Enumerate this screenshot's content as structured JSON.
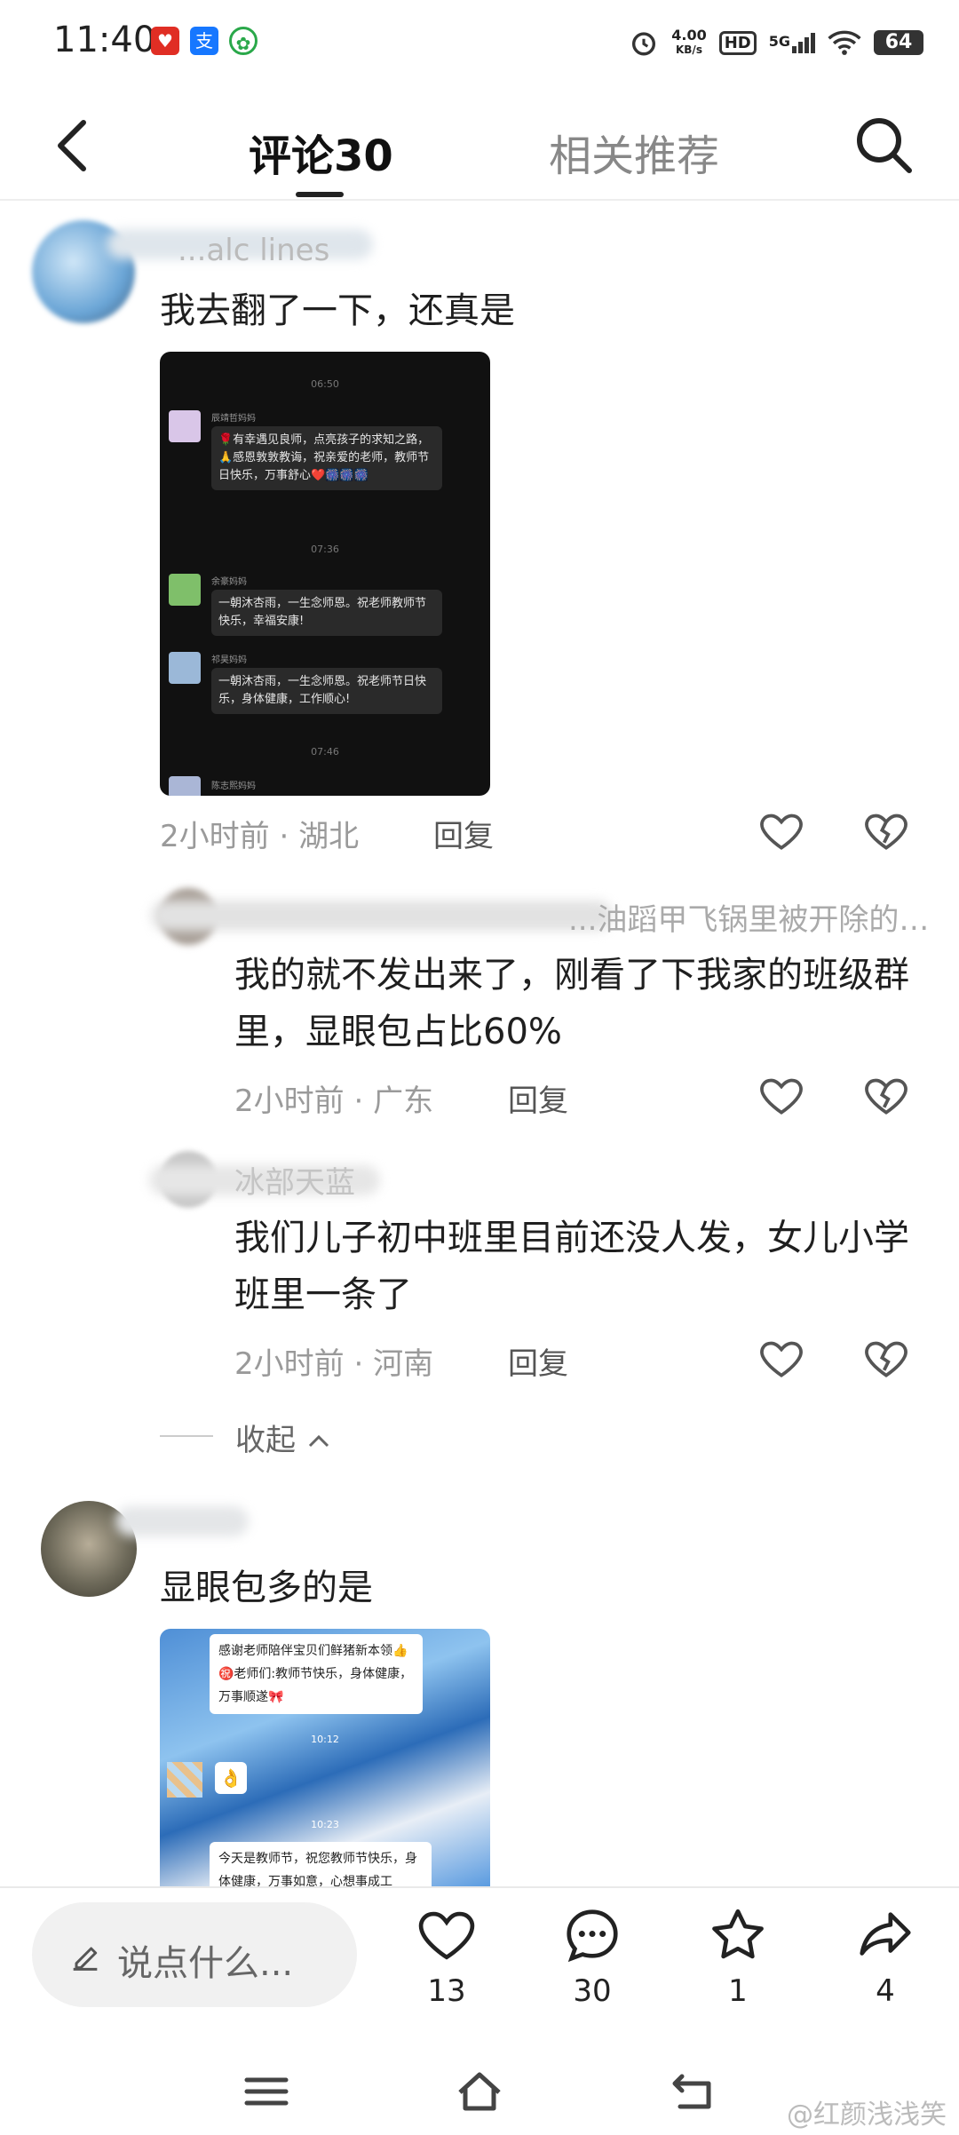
{
  "status_bar": {
    "time": "11:40",
    "net_speed": "4.00",
    "net_unit": "KB/s",
    "hd": "HD",
    "signal": "5G",
    "battery": "64"
  },
  "nav": {
    "tabs": [
      {
        "label": "评论30"
      },
      {
        "label": "相关推荐"
      }
    ]
  },
  "comments": [
    {
      "name": "...alc lines",
      "text": "我去翻了一下，还真是",
      "time": "2小时前",
      "location": "湖北",
      "reply": "回复",
      "image": {
        "times": [
          "06:50",
          "07:36",
          "07:46"
        ],
        "messages": [
          {
            "name": "辰靖哲妈妈",
            "text": "🌹有幸遇见良师，点亮孩子的求知之路，🙏感恩敦敦教诲，祝亲爱的老师，教师节日快乐，万事舒心❤️🎆🎆🎆"
          },
          {
            "name": "余豪妈妈",
            "text": "一朝沐杏雨，一生念师恩。祝老师教师节快乐，幸福安康!"
          },
          {
            "name": "祁昊妈妈",
            "text": "一朝沐杏雨，一生念师恩。祝老师节日快乐，身体健康，工作顺心!"
          },
          {
            "name": "陈志熙妈妈",
            "text": ""
          }
        ]
      }
    },
    {
      "name": "...油蹈甲飞锅里被开除的…",
      "text": "我的就不发出来了，刚看了下我家的班级群里，显眼包占比60%",
      "time": "2小时前",
      "location": "广东",
      "reply": "回复"
    },
    {
      "name": "冰部天蓝",
      "text": "我们儿子初中班里目前还没人发，女儿小学班里一条了",
      "time": "2小时前",
      "location": "河南",
      "reply": "回复"
    },
    {
      "name": "",
      "text": "显眼包多的是",
      "image": {
        "card1": "感谢老师陪伴宝贝们鲜猪新本领👍 ㊗️老师们:教师节快乐，身体健康，万事顺遂🎀",
        "time1": "10:12",
        "time2": "10:23",
        "card2": "今天是教师节，祝您教师节快乐，身体健康，万事如意，心想事成工"
      }
    }
  ],
  "collapse": "收起",
  "bottom": {
    "input_placeholder": "说点什么...",
    "like_count": "13",
    "comment_count": "30",
    "star_count": "1",
    "share_count": "4"
  },
  "watermark": "@红颜浅浅笑",
  "colors": {
    "accent": "#222222",
    "muted": "#9a9a9a"
  }
}
